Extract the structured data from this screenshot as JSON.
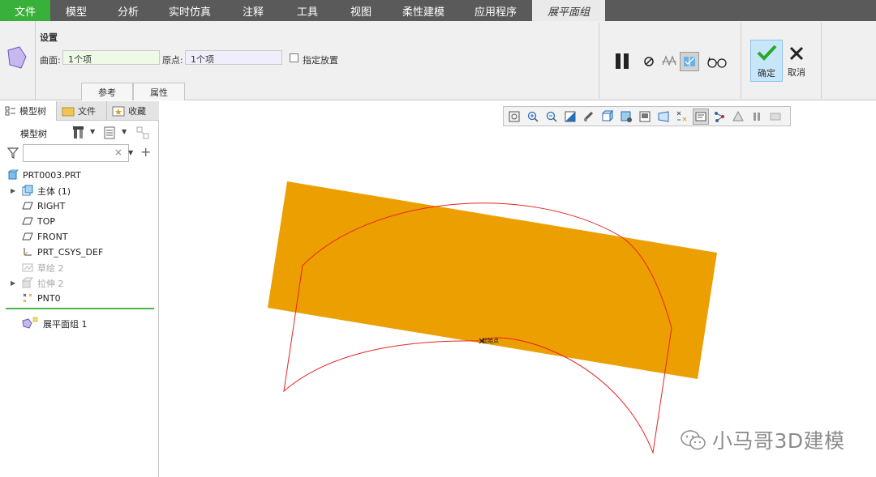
{
  "menu": [
    "文件",
    "模型",
    "分析",
    "实时仿真",
    "注释",
    "工具",
    "视图",
    "柔性建模",
    "应用程序",
    "展平面组"
  ],
  "ribbon": {
    "section_title": "设置",
    "surface_label": "曲面:",
    "surface_value": "1个项",
    "origin_label": "原点:",
    "origin_value": "1个项",
    "checkbox_label": "指定放置",
    "tabs": [
      "参考",
      "属性"
    ],
    "ok_label": "确定",
    "cancel_label": "取消"
  },
  "left_panel": {
    "tabs": [
      "模型树",
      "文件",
      "收藏"
    ],
    "tree_label": "模型树",
    "filter_placeholder": "",
    "root": "PRT0003.PRT",
    "items": [
      {
        "label": "主体 (1)",
        "icon": "body-icon",
        "expandable": true,
        "greyed": false
      },
      {
        "label": "RIGHT",
        "icon": "datum-plane-icon",
        "expandable": false,
        "greyed": false
      },
      {
        "label": "TOP",
        "icon": "datum-plane-icon",
        "expandable": false,
        "greyed": false
      },
      {
        "label": "FRONT",
        "icon": "datum-plane-icon",
        "expandable": false,
        "greyed": false
      },
      {
        "label": "PRT_CSYS_DEF",
        "icon": "coordinate-system-icon",
        "expandable": false,
        "greyed": false
      },
      {
        "label": "草绘 2",
        "icon": "sketch-icon",
        "expandable": false,
        "greyed": true
      },
      {
        "label": "拉伸 2",
        "icon": "extrude-icon",
        "expandable": true,
        "greyed": true
      },
      {
        "label": "PNT0",
        "icon": "datum-point-icon",
        "expandable": false,
        "greyed": false
      }
    ],
    "feature": "展平面组 1"
  },
  "canvas": {
    "origin_label": "起始点",
    "surface_color": "#ec9f00",
    "outline_color": "#e82424"
  },
  "watermark": "小马哥3D建模",
  "colors": {
    "menubar": "#5a5a5a",
    "file_tab": "#39b039",
    "ok_highlight": "#c8e6fa"
  }
}
